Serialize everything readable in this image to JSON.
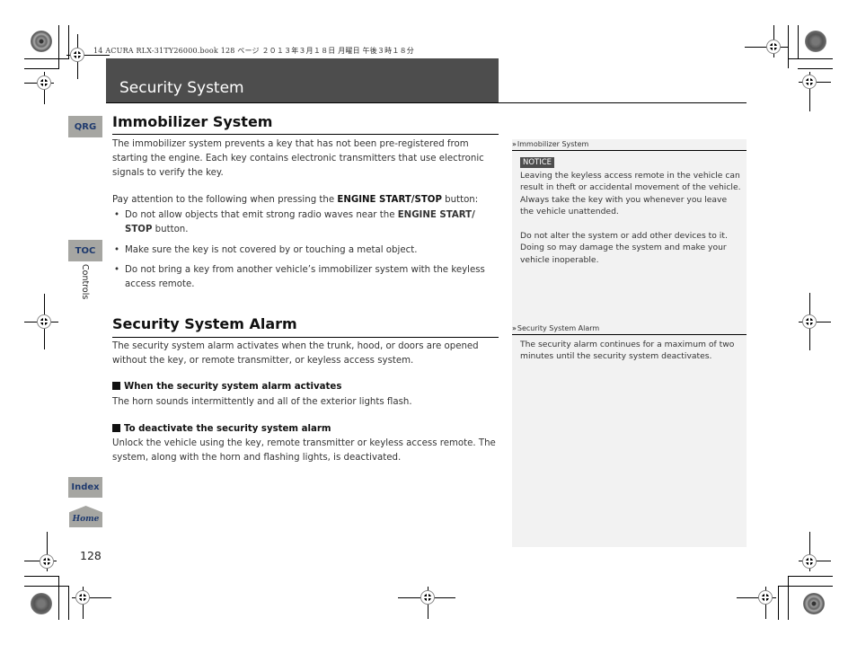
{
  "print_header": "14 ACURA RLX-31TY26000.book  128 ページ  ２０１３年３月１８日  月曜日  午後３時１８分",
  "section_title": "Security System",
  "side_tabs": {
    "qrg": "QRG",
    "toc": "TOC",
    "chapter": "Controls",
    "index": "Index",
    "home": "Home"
  },
  "immobilizer": {
    "heading": "Immobilizer System",
    "intro": "The immobilizer system prevents a key that has not been pre-registered from starting the engine. Each key contains electronic transmitters that use electronic signals to verify the key.",
    "attention_prefix": "Pay attention to the following when pressing the ",
    "attention_bold": "ENGINE START/STOP",
    "attention_suffix": " button:",
    "bullets": [
      {
        "prefix": "Do not allow objects that emit strong radio waves near the ",
        "bold": "ENGINE START/ STOP",
        "suffix": " button."
      },
      {
        "prefix": "Make sure the key is not covered by or touching a metal object.",
        "bold": "",
        "suffix": ""
      },
      {
        "prefix": "Do not bring a key from another vehicle’s immobilizer system with the keyless access remote.",
        "bold": "",
        "suffix": ""
      }
    ]
  },
  "alarm": {
    "heading": "Security System Alarm",
    "intro": "The security system alarm activates when the trunk, hood, or doors are opened without the key, or remote transmitter, or keyless access system.",
    "when_heading": "When the security system alarm activates",
    "when_text": "The horn sounds intermittently and all of the exterior lights flash.",
    "deactivate_heading": "To deactivate the security system alarm",
    "deactivate_text": "Unlock the vehicle using the key, remote transmitter or keyless access remote. The system, along with the horn and flashing lights, is deactivated."
  },
  "sidebar": {
    "immobilizer_ref": "Immobilizer System",
    "notice_label": "NOTICE",
    "notice_text": "Leaving the keyless access remote in the vehicle can result in theft or accidental movement of the vehicle. Always take the key with you whenever you leave the vehicle unattended.",
    "notice_text2": "Do not alter the system or add other devices to it. Doing so may damage the system and make your vehicle inoperable.",
    "alarm_ref": "Security System Alarm",
    "alarm_text": "The security alarm continues for a maximum of two minutes until the security system deactivates."
  },
  "page_number": "128"
}
